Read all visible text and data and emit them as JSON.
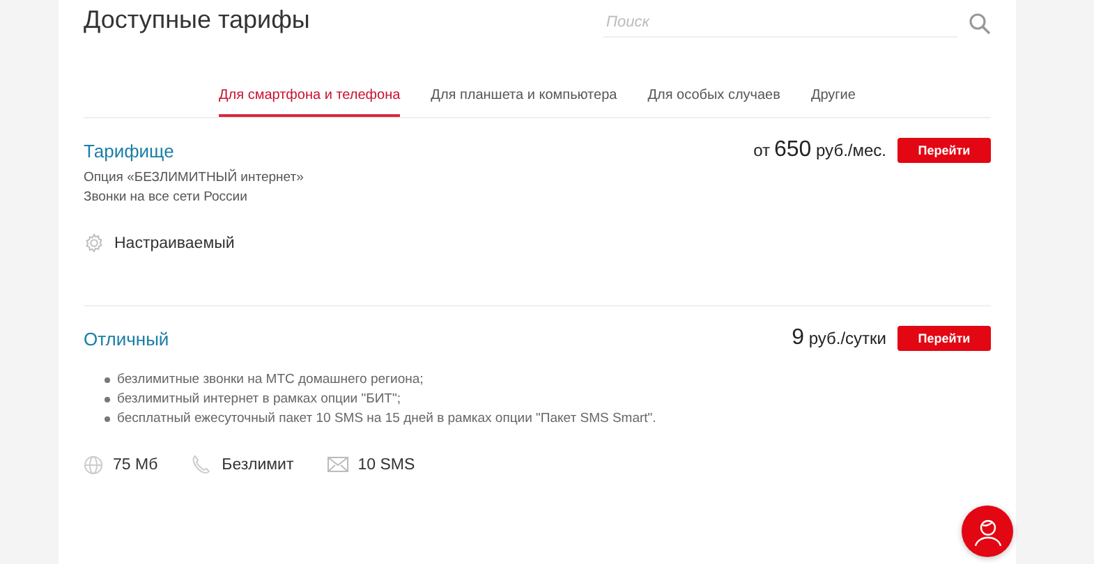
{
  "title": "Доступные тарифы",
  "search": {
    "placeholder": "Поиск"
  },
  "tabs": [
    {
      "label": "Для смартфона и телефона",
      "selected": true
    },
    {
      "label": "Для планшета и компьютера",
      "selected": false
    },
    {
      "label": "Для особых случаев",
      "selected": false
    },
    {
      "label": "Другие",
      "selected": false
    }
  ],
  "tariffs": [
    {
      "name": "Тарифище",
      "kind": "lines",
      "price": {
        "prefix": "от",
        "amount": "650",
        "unit": "руб./мес."
      },
      "button": "Перейти",
      "details": [
        "Опция «БЕЗЛИМИТНЫЙ интернет»",
        "Звонки на все сети России"
      ],
      "features": [
        {
          "kind": "gear",
          "text": "Настраиваемый"
        }
      ]
    },
    {
      "name": "Отличный",
      "kind": "bullets",
      "price": {
        "amount": "9",
        "unit": "руб./сутки"
      },
      "button": "Перейти",
      "details": [
        "безлимитные звонки на МТС домашнего региона;",
        "безлимитный интернет в рамках опции \"БИТ\";",
        "бесплатный ежесуточный пакет 10 SMS на 15 дней в рамках опции \"Пакет SMS Smart\"."
      ],
      "features": [
        {
          "kind": "globe",
          "text": "75 Мб"
        },
        {
          "kind": "phone",
          "text": "Безлимит"
        },
        {
          "kind": "mail",
          "text": "10 SMS"
        }
      ]
    }
  ]
}
